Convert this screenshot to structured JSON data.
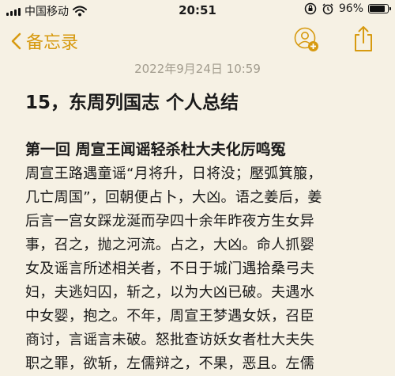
{
  "status_bar": {
    "carrier": "中国移动",
    "time": "20:51",
    "battery_percent": "96%",
    "battery_level": 0.96,
    "icons": [
      "signal-icon",
      "wifi-icon",
      "screen-lock-icon",
      "alarm-icon",
      "battery-icon"
    ]
  },
  "nav": {
    "back_label": "备忘录",
    "accent_color": "#d79a10",
    "icons": [
      "back-chevron-icon",
      "add-person-icon",
      "share-icon"
    ]
  },
  "note": {
    "date": "2022年9月24日 10:59",
    "title": "15，东周列国志 个人总结",
    "chapter_heading": "第一回 周宣王闻谣轻杀杜大夫化厉鸣冤",
    "body_lines": [
      "周宣王路遇童谣“月将升，日将没；壓弧箕箙，",
      "几亡周国”，回朝便占卜，大凶。语之姜后，姜",
      "后言一宫女踩龙涎而孕四十余年昨夜方生女异",
      "事，召之，抛之河流。占之，大凶。命人抓婴",
      "女及谣言所述相关者，不日于城门遇拾桑弓夫",
      "妇，夫逃妇囚，斩之，以为大凶已破。夫遇水",
      "中女婴，抱之。不年，周宣王梦遇女妖，召臣",
      "商讨，言谣言未破。怒批查访妖女者杜大夫失",
      "职之罪，欲斩，左儒辩之，不果，恶且。左儒"
    ]
  }
}
